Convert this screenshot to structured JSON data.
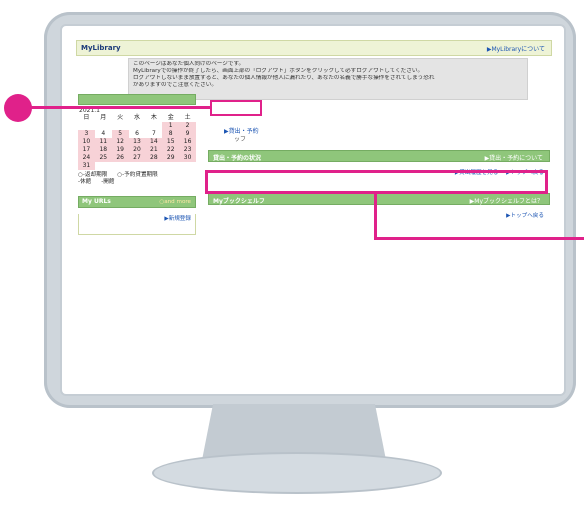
{
  "header": {
    "brand": "MyLibrary",
    "about_link": "▶MyLibraryについて"
  },
  "notice": {
    "lines": [
      "このページはあなた個人向けのページです。",
      "MyLibraryでの操作が終了したら、画面上部の「ログアウト」ボタンをクリックして必ずログアウトしてください。",
      "ログアウトしないまま放置すると、あなたの個人情報が他人に漏れたり、あなたの名義で勝手な操作をされてしまう恐れ",
      "がありますのでご注意ください。"
    ]
  },
  "calendar": {
    "month": "2021.1",
    "weekdays": [
      "日",
      "月",
      "火",
      "水",
      "木",
      "金",
      "土"
    ],
    "days": [
      {
        "d": "",
        "p": false
      },
      {
        "d": "",
        "p": false
      },
      {
        "d": "",
        "p": false
      },
      {
        "d": "",
        "p": false
      },
      {
        "d": "",
        "p": false
      },
      {
        "d": "1",
        "p": true
      },
      {
        "d": "2",
        "p": true
      },
      {
        "d": "3",
        "p": true
      },
      {
        "d": "4",
        "p": false
      },
      {
        "d": "5",
        "p": true
      },
      {
        "d": "6",
        "p": false
      },
      {
        "d": "7",
        "p": false
      },
      {
        "d": "8",
        "p": true
      },
      {
        "d": "9",
        "p": true
      },
      {
        "d": "10",
        "p": true
      },
      {
        "d": "11",
        "p": true
      },
      {
        "d": "12",
        "p": true
      },
      {
        "d": "13",
        "p": true
      },
      {
        "d": "14",
        "p": true
      },
      {
        "d": "15",
        "p": true
      },
      {
        "d": "16",
        "p": true
      },
      {
        "d": "17",
        "p": true
      },
      {
        "d": "18",
        "p": true
      },
      {
        "d": "19",
        "p": true
      },
      {
        "d": "20",
        "p": true
      },
      {
        "d": "21",
        "p": true
      },
      {
        "d": "22",
        "p": true
      },
      {
        "d": "23",
        "p": true
      },
      {
        "d": "24",
        "p": true
      },
      {
        "d": "25",
        "p": true
      },
      {
        "d": "26",
        "p": true
      },
      {
        "d": "27",
        "p": true
      },
      {
        "d": "28",
        "p": true
      },
      {
        "d": "29",
        "p": true
      },
      {
        "d": "30",
        "p": true
      },
      {
        "d": "31",
        "p": true
      }
    ],
    "legend": {
      "row1": [
        "○-返却期限",
        "○-予約貸置期限"
      ],
      "row2": [
        "-休館",
        "-開館"
      ]
    }
  },
  "myurls": {
    "title": "My URLs",
    "more": "○and more",
    "new_link": "▶新規登録"
  },
  "tabs": {
    "lend_reserve": "▶貸出・予約",
    "sub": "ッフ"
  },
  "sections": {
    "status": {
      "title": "貸出・予約の状況",
      "about": "▶貸出・予約について",
      "links": [
        "▶貸出履歴を見る",
        "▶トップへ戻る"
      ]
    },
    "bookshelf": {
      "title": "Myブックシェルフ",
      "about": "▶Myブックシェルフとは？",
      "top": "▶トップへ戻る"
    }
  },
  "colors": {
    "highlight": "#e0218a",
    "bar_green": "#8fc67b",
    "header_bg": "#eef3d6"
  }
}
